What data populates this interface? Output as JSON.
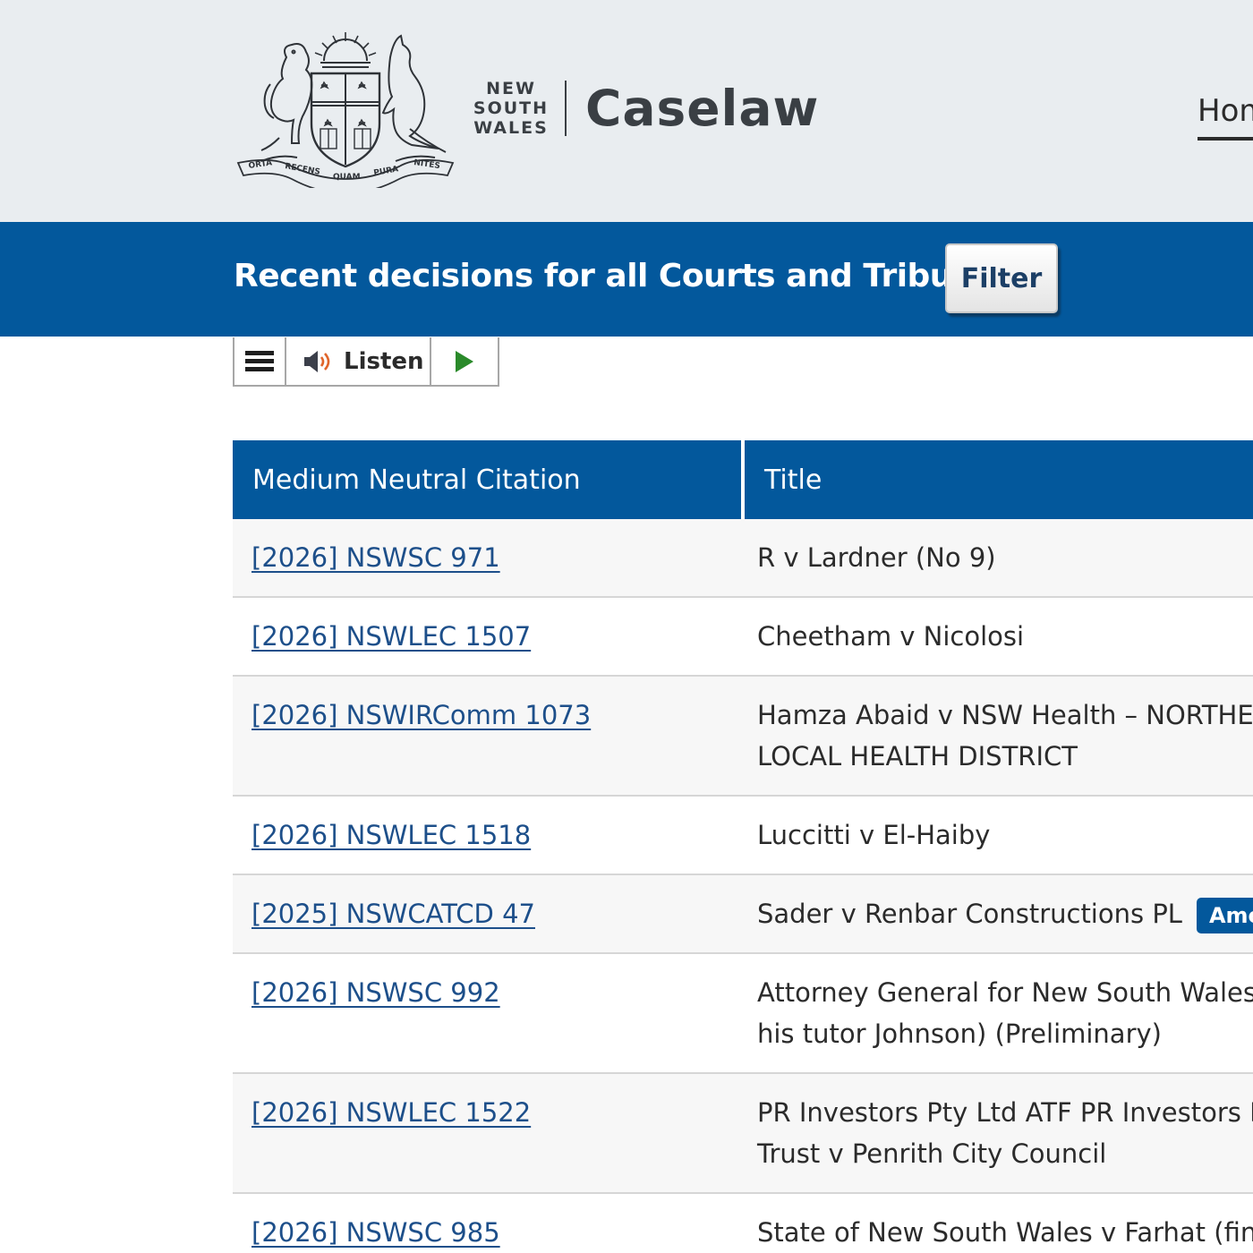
{
  "header": {
    "crest_motto": "ORTA RECENS QUAM PURA NITES",
    "state_words": [
      "NEW",
      "SOUTH",
      "WALES"
    ],
    "brand_title": "Caselaw",
    "nav": {
      "home_label": "Hom"
    }
  },
  "banner": {
    "title": "Recent decisions for all Courts and Tribunals",
    "filter_label": "Filter"
  },
  "listen_bar": {
    "menu_icon": "hamburger-menu-icon",
    "listen_label": "Listen",
    "speaker_icon": "speaker-icon",
    "play_icon": "play-icon"
  },
  "table": {
    "columns": [
      "Medium Neutral Citation",
      "Title"
    ],
    "rows": [
      {
        "citation": "[2026] NSWSC 971",
        "title_lines": [
          "R v Lardner (No 9)"
        ],
        "badge": ""
      },
      {
        "citation": "[2026] NSWLEC 1507",
        "title_lines": [
          "Cheetham v Nicolosi"
        ],
        "badge": ""
      },
      {
        "citation": "[2026] NSWIRComm 1073",
        "title_lines": [
          "Hamza Abaid v NSW Health – NORTHER",
          "LOCAL HEALTH DISTRICT"
        ],
        "badge": ""
      },
      {
        "citation": "[2026] NSWLEC 1518",
        "title_lines": [
          "Luccitti v El-Haiby"
        ],
        "badge": ""
      },
      {
        "citation": "[2025] NSWCATCD 47",
        "title_lines": [
          "Sader v Renbar Constructions PL"
        ],
        "badge": "Amenc"
      },
      {
        "citation": "[2026] NSWSC 992",
        "title_lines": [
          "Attorney General for New South Wales v",
          "his tutor Johnson) (Preliminary)"
        ],
        "badge": ""
      },
      {
        "citation": "[2026] NSWLEC 1522",
        "title_lines": [
          "PR Investors Pty Ltd ATF PR Investors Fi",
          "Trust v Penrith City Council"
        ],
        "badge": ""
      },
      {
        "citation": "[2026] NSWSC 985",
        "title_lines": [
          "State of New South Wales v Farhat (fina"
        ],
        "badge": ""
      }
    ]
  },
  "colors": {
    "header_bg": "#e9edf0",
    "brand_blue": "#03589c",
    "link_blue": "#1d4f8a",
    "row_alt": "#f7f7f7",
    "play_green": "#2a8a2a",
    "speaker_orange": "#e0652b"
  }
}
